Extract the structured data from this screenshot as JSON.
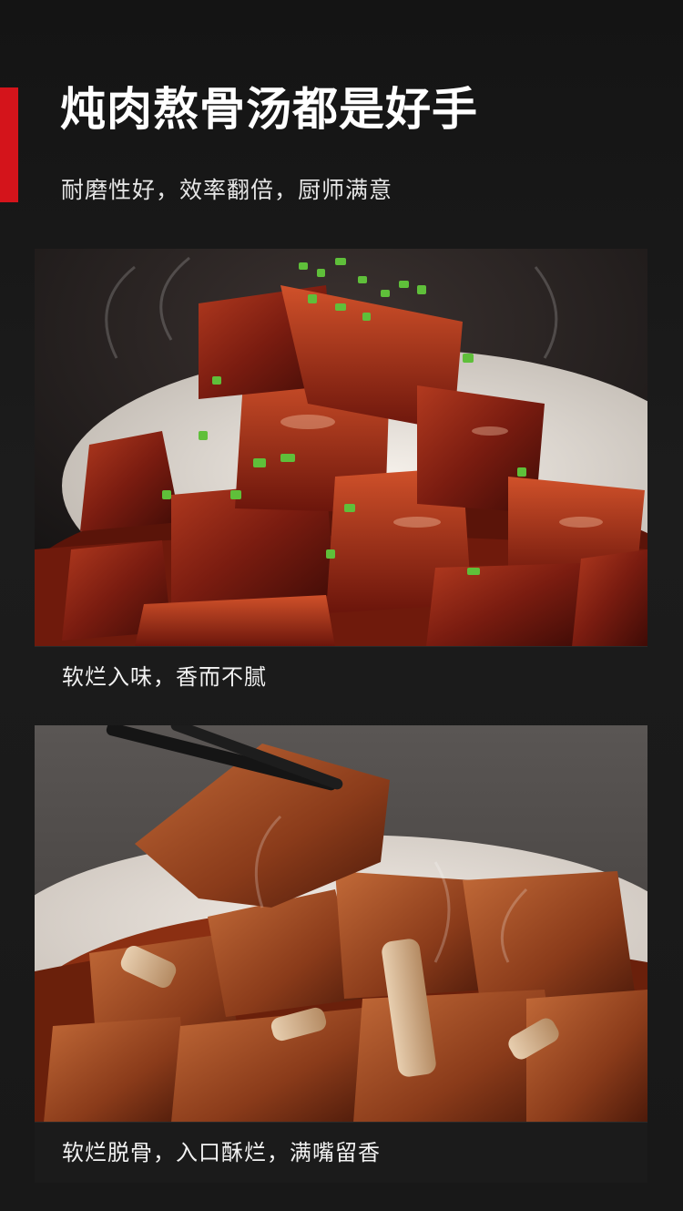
{
  "header": {
    "title": "炖肉熬骨汤都是好手",
    "subtitle": "耐磨性好，效率翻倍，厨师满意",
    "accent_color": "#d4141b"
  },
  "cards": [
    {
      "image": "braised-pork-belly-photo",
      "caption": "软烂入味，香而不腻"
    },
    {
      "image": "braised-spare-ribs-photo",
      "caption": "软烂脱骨，入口酥烂，满嘴留香"
    }
  ]
}
